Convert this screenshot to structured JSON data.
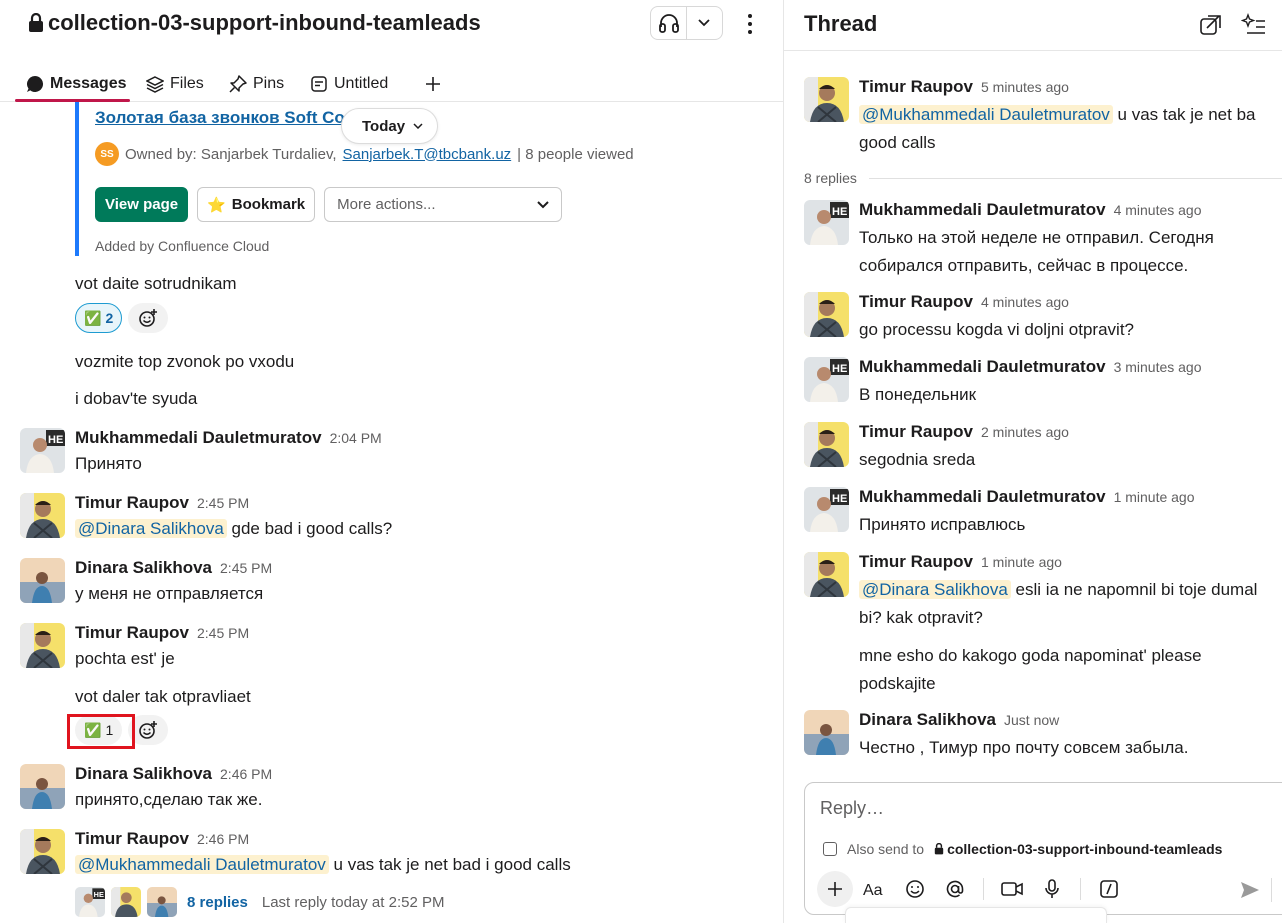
{
  "channel": {
    "name": "collection-03-support-inbound-teamleads",
    "tabs": [
      {
        "label": "Messages",
        "icon": "message-icon",
        "active": true
      },
      {
        "label": "Files",
        "icon": "layers-icon"
      },
      {
        "label": "Pins",
        "icon": "pin-icon"
      },
      {
        "label": "Untitled",
        "icon": "canvas-icon"
      }
    ],
    "date_divider": "Today"
  },
  "unfurl": {
    "link_text": "Золотая база звонков Soft Co",
    "owner_prefix": "Owned by: Sanjarbek Turdaliev,",
    "owner_initials": "SS",
    "owner_email": "Sanjarbek.T@tbcbank.uz",
    "views": "| 8 people viewed",
    "view_page": "View page",
    "bookmark": "Bookmark",
    "more_actions": "More actions...",
    "added_by": "Added by Confluence Cloud"
  },
  "messages": {
    "t1": "vot daite sotrudnikam",
    "r1_count": "2",
    "t2": "vozmite top zvonok po vxodu",
    "t3": "i dobav'te syuda",
    "m1": {
      "name": "Mukhammedali Dauletmuratov",
      "time": "2:04 PM",
      "body": "Принято"
    },
    "m2": {
      "name": "Timur Raupov",
      "time": "2:45 PM",
      "mention": "@Dinara Salikhova",
      "body": " gde bad i good calls?"
    },
    "m3": {
      "name": "Dinara Salikhova",
      "time": "2:45 PM",
      "body": "у меня не отправляется"
    },
    "m4": {
      "name": "Timur Raupov",
      "time": "2:45 PM",
      "body": "pochta est' je"
    },
    "t4": "vot daler tak otpravliaet",
    "r2_count": "1",
    "m5": {
      "name": "Dinara Salikhova",
      "time": "2:46 PM",
      "body": "принято,сделаю так же."
    },
    "m6": {
      "name": "Timur Raupov",
      "time": "2:46 PM",
      "mention": "@Mukhammedali Dauletmuratov",
      "body": " u vas tak je net bad i good calls"
    },
    "replies": "8 replies",
    "last_reply": "Last reply today at 2:52 PM"
  },
  "thread": {
    "title": "Thread",
    "root": {
      "name": "Timur Raupov",
      "time": "5 minutes ago",
      "mention": "@Mukhammedali Dauletmuratov",
      "line1": " u vas tak je net ba",
      "line2": "good calls"
    },
    "reply_count": "8 replies",
    "r1": {
      "name": "Mukhammedali Dauletmuratov",
      "time": "4 minutes ago",
      "line1": "Только на этой неделе не отправил. Сегодня",
      "line2": "собирался отправить, сейчас в процессе."
    },
    "r2": {
      "name": "Timur Raupov",
      "time": "4 minutes ago",
      "line1": "go processu kogda vi doljni otpravit?"
    },
    "r3": {
      "name": "Mukhammedali Dauletmuratov",
      "time": "3 minutes ago",
      "line1": "В понедельник"
    },
    "r4": {
      "name": "Timur Raupov",
      "time": "2 minutes ago",
      "line1": "segodnia sreda"
    },
    "r5": {
      "name": "Mukhammedali Dauletmuratov",
      "time": "1 minute ago",
      "line1": "Принято исправлюсь"
    },
    "r6": {
      "name": "Timur Raupov",
      "time": "1 minute ago",
      "mention": "@Dinara Salikhova",
      "line1": " esli ia ne napomnil bi toje dumal",
      "line2": "bi? kak otpravit?",
      "line3": "mne esho do kakogo goda napominat' please",
      "line4": "podskajite"
    },
    "r7": {
      "name": "Dinara Salikhova",
      "time": "Just now",
      "line1": "Честно , Тимур про почту совсем забыла."
    },
    "composer_placeholder": "Reply…",
    "also_send_label": "Also send to",
    "also_send_channel": "collection-03-support-inbound-teamleads"
  },
  "colors": {
    "accent_tab": "#c0174a",
    "link": "#1264a3",
    "primary_button": "#007a5a",
    "unfurl_bar": "#1d7afc",
    "highlight": "#e0141e"
  }
}
